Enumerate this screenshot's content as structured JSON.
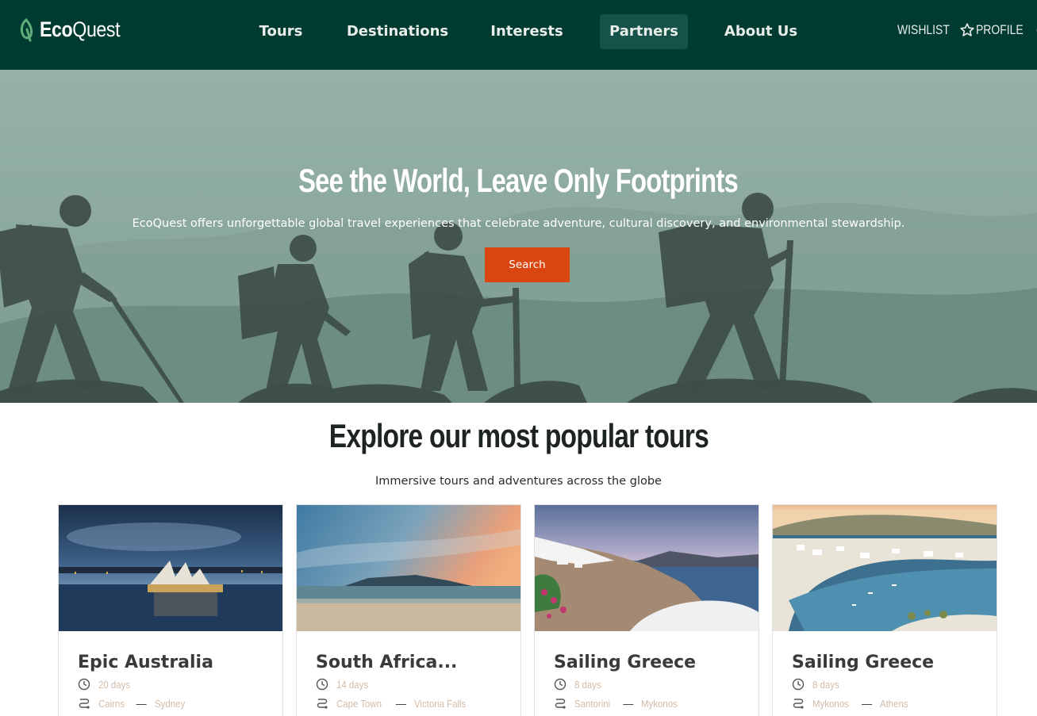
{
  "brand": {
    "name_bold": "Eco",
    "name_regular": "Quest"
  },
  "nav": {
    "items": [
      {
        "label": "Tours"
      },
      {
        "label": "Destinations"
      },
      {
        "label": "Interests"
      },
      {
        "label": "Partners",
        "active": true
      },
      {
        "label": "About Us"
      }
    ]
  },
  "utility": {
    "wishlist": "WISHLIST",
    "profile": "PROFILE"
  },
  "hero": {
    "title": "See the World, Leave Only Footprints",
    "subtitle": "EcoQuest offers unforgettable global travel experiences that celebrate adventure, cultural discovery, and environmental stewardship.",
    "button": "Search"
  },
  "popular": {
    "title": "Explore our most popular tours",
    "subtitle": "Immersive tours and adventures across the globe"
  },
  "tours": [
    {
      "title": "Epic Australia",
      "duration": "20 days",
      "from": "Cairns",
      "to": "Sydney"
    },
    {
      "title": "South Africa...",
      "duration": "14 days",
      "from": "Cape Town",
      "to": "Victoria Falls"
    },
    {
      "title": "Sailing Greece",
      "duration": "8 days",
      "from": "Santorini",
      "to": "Mykonos"
    },
    {
      "title": "Sailing Greece",
      "duration": "8 days",
      "from": "Mykonos",
      "to": "Athens"
    }
  ],
  "colors": {
    "header_bg": "#003b32",
    "nav_active_bg": "#16514a",
    "accent": "#d94610",
    "meta_text": "#d4bcaa"
  },
  "icons": [
    "leaf-icon",
    "star-icon",
    "user-circle-icon",
    "clock-icon",
    "route-icon"
  ]
}
